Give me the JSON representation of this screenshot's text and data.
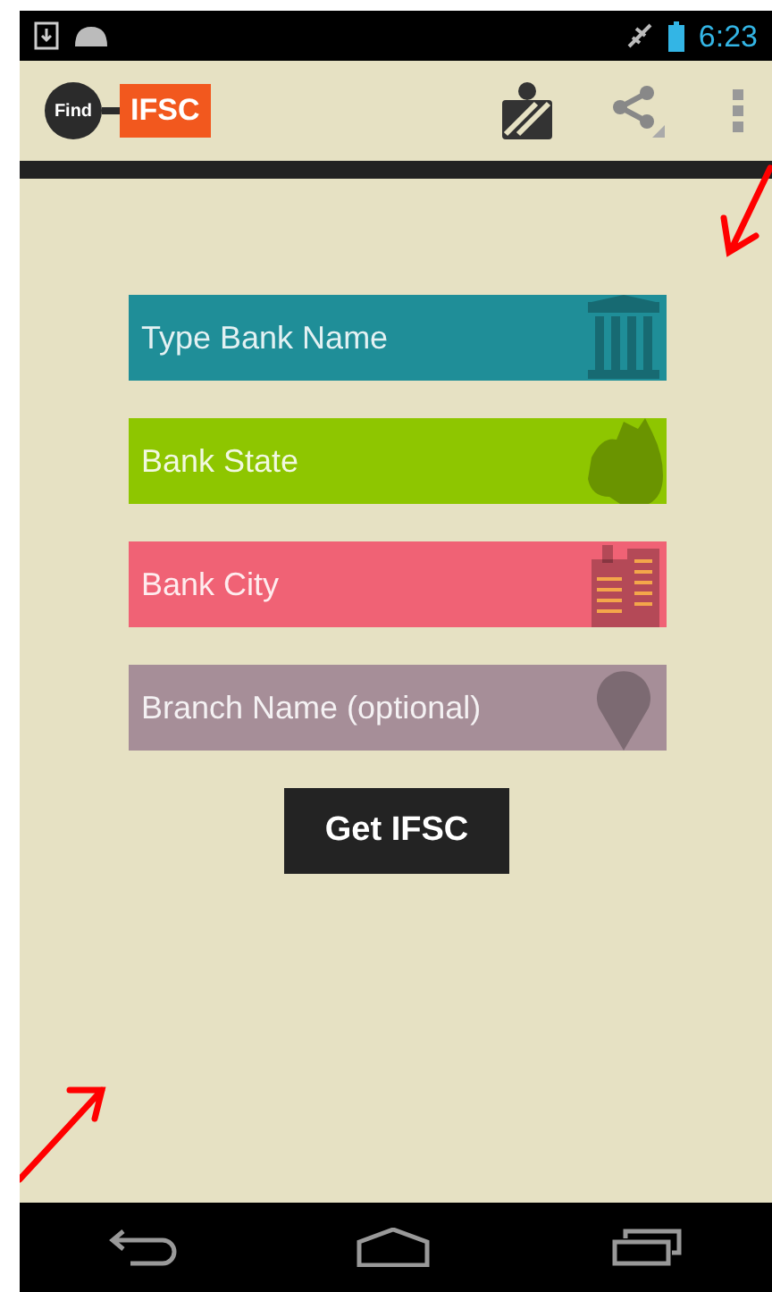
{
  "status_bar": {
    "time": "6:23"
  },
  "app_bar": {
    "logo": {
      "left": "Find",
      "right": "IFSC"
    }
  },
  "fields": [
    {
      "kind": "bank",
      "placeholder": "Type Bank Name",
      "color": "#1f8e98"
    },
    {
      "kind": "state",
      "placeholder": "Bank State",
      "color": "#8ec600"
    },
    {
      "kind": "city",
      "placeholder": "Bank City",
      "color": "#f06275"
    },
    {
      "kind": "branch",
      "placeholder": "Branch Name (optional)",
      "color": "#a68e98"
    }
  ],
  "submit": {
    "label": "Get IFSC"
  }
}
